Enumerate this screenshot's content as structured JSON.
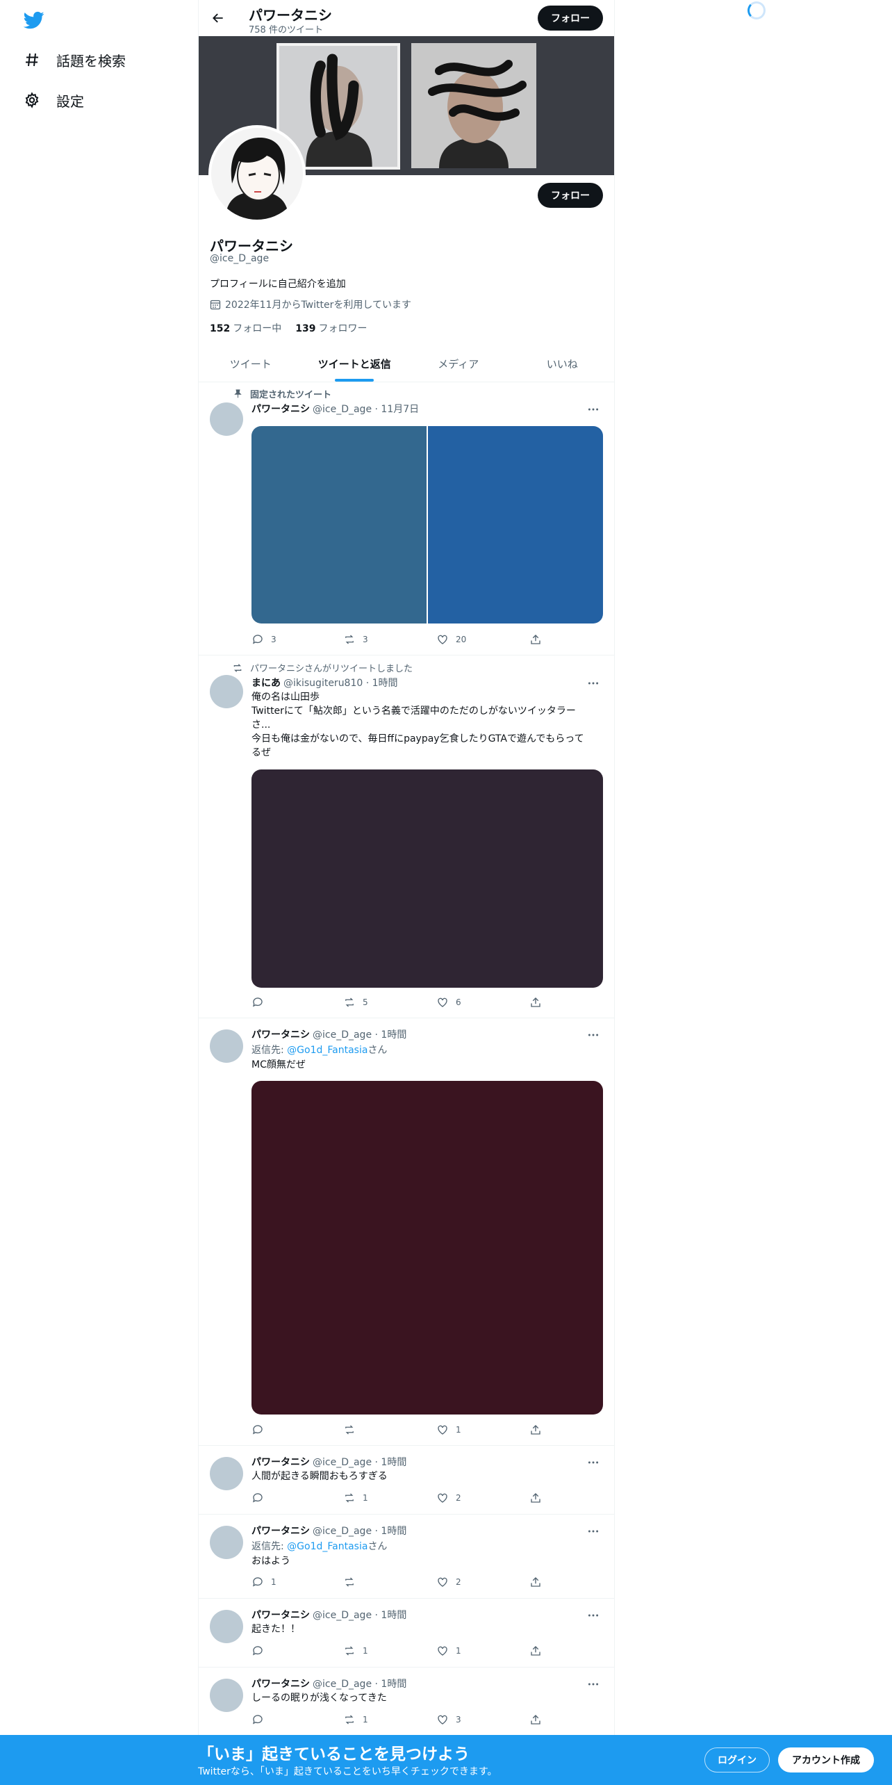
{
  "sidebar": {
    "items": [
      {
        "label": "話題を検索",
        "icon": "hashtag-icon"
      },
      {
        "label": "設定",
        "icon": "gear-icon"
      }
    ]
  },
  "header": {
    "name": "パワータニシ",
    "tweet_count": "758 件のツイート",
    "follow_label": "フォロー"
  },
  "profile": {
    "name": "パワータニシ",
    "handle": "@ice_D_age",
    "bio": "プロフィールに自己紹介を追加",
    "joined": "2022年11月からTwitterを利用しています",
    "following_count": "152",
    "following_label": "フォロー中",
    "followers_count": "139",
    "followers_label": "フォロワー",
    "follow_label": "フォロー"
  },
  "tabs": [
    {
      "label": "ツイート",
      "active": false
    },
    {
      "label": "ツイートと返信",
      "active": true
    },
    {
      "label": "メディア",
      "active": false
    },
    {
      "label": "いいね",
      "active": false
    }
  ],
  "tweets": [
    {
      "context": "固定されたツイート",
      "name": "パワータニシ",
      "meta": "@ice_D_age · 11月7日",
      "media_colors": [
        "#33688f",
        "#2361a3"
      ],
      "reply": "3",
      "retweet": "3",
      "like": "20"
    },
    {
      "context": "パワータニシさんがリツイートしました",
      "name": "まにあ",
      "meta": "@ikisugiteru810 · 1時間",
      "text_lines": [
        "俺の名は山田歩",
        "Twitterにて「鮎次郎」という名義で活躍中のただのしがないツイッタラー",
        "さ...",
        "今日も俺は金がないので、毎日ffにpaypay乞食したりGTAで遊んでもらって",
        "るぜ"
      ],
      "media_colors": [
        "#2f2533"
      ],
      "reply": "",
      "retweet": "5",
      "like": "6"
    },
    {
      "name": "パワータニシ",
      "meta": "@ice_D_age · 1時間",
      "reply_prefix": "返信先: ",
      "reply_to": "@Go1d_Fantasia",
      "reply_suffix": "さん",
      "text": "MC顔無だぜ",
      "media_colors": [
        "#3a1420"
      ],
      "reply": "",
      "retweet": "",
      "like": "1"
    },
    {
      "name": "パワータニシ",
      "meta": "@ice_D_age · 1時間",
      "text": "人間が起きる瞬間おもろすぎる",
      "reply": "",
      "retweet": "1",
      "like": "2"
    },
    {
      "name": "パワータニシ",
      "meta": "@ice_D_age · 1時間",
      "reply_prefix": "返信先: ",
      "reply_to": "@Go1d_Fantasia",
      "reply_suffix": "さん",
      "text": "おはよう",
      "reply": "1",
      "retweet": "",
      "like": "2"
    },
    {
      "name": "パワータニシ",
      "meta": "@ice_D_age · 1時間",
      "text": "起きた！！",
      "reply": "",
      "retweet": "1",
      "like": "1"
    },
    {
      "name": "パワータニシ",
      "meta": "@ice_D_age · 1時間",
      "text": "しーるの眠りが浅くなってきた",
      "reply": "",
      "retweet": "1",
      "like": "3"
    }
  ],
  "bottom_bar": {
    "title": "「いま」起きていることを見つけよう",
    "subtitle": "Twitterなら、「いま」起きていることをいち早くチェックできます。",
    "login": "ログイン",
    "signup": "アカウント作成"
  },
  "colors": {
    "accent": "#1d9bf0",
    "banner": "#3a3d44",
    "avatar_placeholder": "#bccad4"
  }
}
